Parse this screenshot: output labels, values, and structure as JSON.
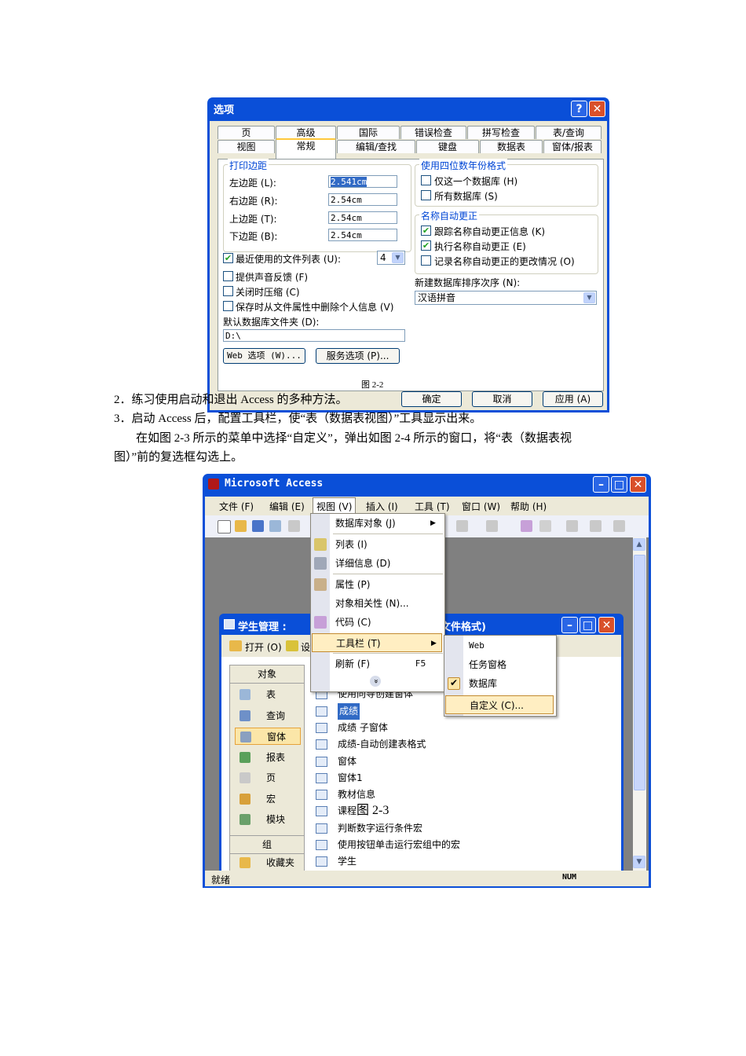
{
  "options_dialog": {
    "title": "选项",
    "help_glyph": "?",
    "close_glyph": "✕",
    "tabs_row1": [
      "页",
      "高级",
      "国际",
      "错误检查",
      "拼写检查",
      "表/查询"
    ],
    "tabs_row2": [
      "视图",
      "常规",
      "编辑/查找",
      "键盘",
      "数据表",
      "窗体/报表"
    ],
    "active_tab": "常规",
    "print_margins": {
      "group_title": "打印边距",
      "left_label": "左边距 (L):",
      "left_value": "2.541cm",
      "right_label": "右边距 (R):",
      "right_value": "2.54cm",
      "top_label": "上边距 (T):",
      "top_value": "2.54cm",
      "bottom_label": "下边距 (B):",
      "bottom_value": "2.54cm"
    },
    "year_format": {
      "group_title": "使用四位数年份格式",
      "this_db_label": "仅这一个数据库 (H)",
      "this_db_checked": false,
      "all_db_label": "所有数据库 (S)",
      "all_db_checked": false
    },
    "name_autocorrect": {
      "group_title": "名称自动更正",
      "track_label": "跟踪名称自动更正信息 (K)",
      "track_checked": true,
      "perform_label": "执行名称自动更正 (E)",
      "perform_checked": true,
      "log_label": "记录名称自动更正的更改情况 (O)",
      "log_checked": false
    },
    "recent_files_label": "最近使用的文件列表 (U):",
    "recent_files_checked": true,
    "recent_files_value": "4",
    "sound_feedback_label": "提供声音反馈 (F)",
    "compact_on_close_label": "关闭时压缩 (C)",
    "remove_personal_label": "保存时从文件属性中删除个人信息 (V)",
    "sort_order_label": "新建数据库排序次序 (N):",
    "sort_order_value": "汉语拼音",
    "default_folder_label": "默认数据库文件夹 (D):",
    "default_folder_value": "D:\\",
    "web_options_button": "Web 选项 (W)...",
    "service_options_button": "服务选项 (P)...",
    "ok_button": "确定",
    "cancel_button": "取消",
    "apply_button": "应用 (A)"
  },
  "document": {
    "caption_fig22": "图 2-2",
    "line2": "2．练习使用启动和退出 Access 的多种方法。",
    "line3": "3．启动 Access 后，配置工具栏，使“表（数据表视图）”工具显示出来。",
    "para_line1": "在如图 2-3 所示的菜单中选择“自定义”，弹出如图 2-4 所示的窗口，将“表（数据表视",
    "para_line2": "图）”前的复选框勾选上。",
    "caption_fig23": "图 2-3"
  },
  "access_window": {
    "title": "Microsoft Access",
    "menu": [
      "文件 (F)",
      "编辑 (E)",
      "视图 (V)",
      "插入 (I)",
      "工具 (T)",
      "窗口 (W)",
      "帮助 (H)"
    ],
    "status_text": "就绪",
    "status_num": "NUM",
    "child_window": {
      "title": "学生管理 :",
      "title_right": "文件格式)",
      "open_button": "打开 (O)",
      "design_button": "设",
      "objects_header": "对象",
      "objects": [
        "表",
        "查询",
        "窗体",
        "报表",
        "页",
        "宏",
        "模块"
      ],
      "selected_object": "窗体",
      "groups_header": "组",
      "favorites": "收藏夹",
      "list_items": [
        "使用向导创建窗体",
        "成绩",
        "成绩 子窗体",
        "成绩-自动创建表格式",
        "窗体",
        "窗体1",
        "教材信息",
        "课程",
        "判断数字运行条件宏",
        "使用按钮单击运行宏组中的宏",
        "学生"
      ],
      "selected_list_item": "成绩"
    },
    "view_menu": {
      "items": [
        "数据库对象 (J)",
        "列表 (I)",
        "详细信息 (D)",
        "属性 (P)",
        "对象相关性 (N)...",
        "代码 (C)",
        "工具栏 (T)",
        "刷新 (F)"
      ],
      "refresh_shortcut": "F5",
      "expand_glyph": "»"
    },
    "toolbars_submenu": {
      "items": [
        "Web",
        "任务窗格",
        "数据库",
        "自定义 (C)..."
      ],
      "checked_item": "数据库",
      "highlighted_item": "自定义 (C)..."
    }
  }
}
